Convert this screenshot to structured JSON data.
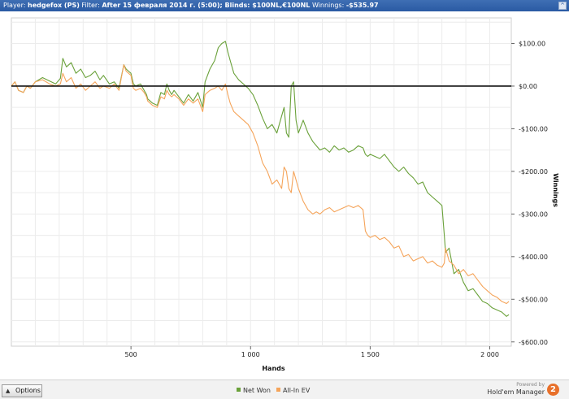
{
  "titlebar": {
    "player_label": "Player:",
    "player_value": "hedgefox (PS)",
    "filter_label": "Filter:",
    "filter_value": "After 15 февраля 2014 г. (5:00); Blinds: $100NL,€100NL",
    "winnings_label": "Winnings:",
    "winnings_value": "-$535.97",
    "collapse_icon": "chevron-up-icon",
    "collapse_glyph": "^"
  },
  "chart_data": {
    "type": "line",
    "xlabel": "Hands",
    "ylabel": "Winnings",
    "xlim": [
      0,
      2090
    ],
    "ylim": [
      -610,
      160
    ],
    "x_ticks": [
      500,
      1000,
      1500,
      2000
    ],
    "x_tick_labels": [
      "500",
      "1 000",
      "1 500",
      "2 000"
    ],
    "y_ticks": [
      100,
      0,
      -100,
      -200,
      -300,
      -400,
      -500,
      -600
    ],
    "y_tick_labels": [
      "$100.00",
      "$0.00",
      "-$100.00",
      "-$200.00",
      "-$300.00",
      "-$400.00",
      "-$500.00",
      "-$600.00"
    ],
    "grid": true,
    "zero_line": true,
    "legend_position": "bottom",
    "series": [
      {
        "name": "Net Won",
        "color": "#6aa13a",
        "x": [
          0,
          15,
          30,
          50,
          65,
          80,
          100,
          130,
          160,
          185,
          205,
          215,
          230,
          250,
          270,
          290,
          310,
          330,
          350,
          370,
          385,
          410,
          430,
          450,
          470,
          480,
          500,
          510,
          520,
          540,
          555,
          565,
          570,
          590,
          610,
          625,
          640,
          650,
          660,
          670,
          680,
          700,
          720,
          740,
          760,
          780,
          800,
          810,
          830,
          850,
          865,
          880,
          895,
          905,
          915,
          930,
          950,
          970,
          990,
          1010,
          1030,
          1050,
          1070,
          1090,
          1110,
          1130,
          1140,
          1150,
          1160,
          1170,
          1180,
          1190,
          1200,
          1220,
          1240,
          1260,
          1275,
          1290,
          1310,
          1330,
          1350,
          1370,
          1390,
          1410,
          1430,
          1450,
          1470,
          1480,
          1490,
          1500,
          1520,
          1540,
          1560,
          1580,
          1600,
          1620,
          1640,
          1660,
          1680,
          1700,
          1720,
          1740,
          1760,
          1780,
          1800,
          1810,
          1815,
          1830,
          1850,
          1870,
          1890,
          1910,
          1930,
          1950,
          1970,
          1990,
          2010,
          2030,
          2050,
          2070,
          2080
        ],
        "y": [
          0,
          10,
          -10,
          -15,
          0,
          -5,
          10,
          20,
          12,
          5,
          18,
          65,
          45,
          55,
          30,
          40,
          20,
          25,
          35,
          15,
          25,
          5,
          10,
          -5,
          50,
          40,
          30,
          5,
          0,
          5,
          -10,
          -20,
          -30,
          -40,
          -45,
          -15,
          -20,
          5,
          -10,
          -20,
          -10,
          -25,
          -40,
          -20,
          -35,
          -15,
          -50,
          10,
          40,
          60,
          90,
          100,
          105,
          80,
          60,
          30,
          15,
          5,
          -5,
          -20,
          -45,
          -75,
          -100,
          -90,
          -110,
          -70,
          -50,
          -110,
          -120,
          0,
          10,
          -80,
          -110,
          -80,
          -110,
          -130,
          -140,
          -150,
          -145,
          -155,
          -140,
          -150,
          -145,
          -155,
          -150,
          -140,
          -145,
          -160,
          -165,
          -160,
          -165,
          -170,
          -160,
          -175,
          -190,
          -200,
          -190,
          -205,
          -215,
          -230,
          -225,
          -250,
          -260,
          -270,
          -280,
          -350,
          -390,
          -380,
          -440,
          -430,
          -460,
          -480,
          -475,
          -490,
          -505,
          -510,
          -520,
          -525,
          -530,
          -540,
          -536
        ]
      },
      {
        "name": "All-In EV",
        "color": "#f5a45a",
        "x": [
          0,
          15,
          30,
          50,
          65,
          80,
          100,
          130,
          160,
          185,
          205,
          215,
          230,
          250,
          270,
          290,
          310,
          330,
          350,
          370,
          385,
          410,
          430,
          450,
          470,
          480,
          500,
          510,
          520,
          540,
          555,
          565,
          570,
          590,
          610,
          625,
          640,
          650,
          660,
          670,
          680,
          700,
          720,
          740,
          760,
          780,
          800,
          810,
          830,
          850,
          865,
          880,
          895,
          905,
          915,
          930,
          950,
          970,
          990,
          1010,
          1030,
          1050,
          1070,
          1090,
          1110,
          1130,
          1140,
          1150,
          1160,
          1170,
          1180,
          1190,
          1200,
          1220,
          1240,
          1260,
          1275,
          1290,
          1310,
          1330,
          1350,
          1370,
          1390,
          1410,
          1430,
          1450,
          1470,
          1480,
          1490,
          1500,
          1520,
          1540,
          1560,
          1580,
          1600,
          1620,
          1640,
          1660,
          1680,
          1700,
          1720,
          1740,
          1760,
          1780,
          1800,
          1810,
          1815,
          1830,
          1850,
          1870,
          1890,
          1910,
          1930,
          1950,
          1970,
          1990,
          2010,
          2030,
          2050,
          2070,
          2080
        ],
        "y": [
          0,
          10,
          -10,
          -15,
          0,
          -5,
          10,
          15,
          5,
          0,
          5,
          30,
          10,
          20,
          -5,
          5,
          -10,
          0,
          10,
          -5,
          0,
          -5,
          5,
          -10,
          50,
          35,
          25,
          -5,
          -10,
          -5,
          -15,
          -25,
          -35,
          -45,
          -50,
          -25,
          -30,
          -10,
          -20,
          -25,
          -20,
          -30,
          -45,
          -30,
          -40,
          -30,
          -60,
          -20,
          -10,
          -5,
          0,
          -10,
          5,
          -20,
          -40,
          -60,
          -70,
          -80,
          -90,
          -110,
          -140,
          -180,
          -200,
          -230,
          -220,
          -240,
          -190,
          -200,
          -240,
          -250,
          -200,
          -220,
          -240,
          -270,
          -290,
          -300,
          -295,
          -300,
          -290,
          -285,
          -295,
          -290,
          -285,
          -280,
          -285,
          -280,
          -290,
          -340,
          -350,
          -355,
          -350,
          -360,
          -355,
          -365,
          -380,
          -375,
          -400,
          -395,
          -410,
          -405,
          -400,
          -415,
          -410,
          -420,
          -425,
          -415,
          -380,
          -410,
          -420,
          -440,
          -430,
          -445,
          -440,
          -455,
          -470,
          -480,
          -490,
          -495,
          -505,
          -510,
          -505
        ]
      }
    ]
  },
  "footer": {
    "options_label": "Options",
    "options_icon": "triangle-up-icon",
    "options_glyph": "▲",
    "powered_text": "Powered by",
    "brand_text": "Hold'em Manager",
    "brand_badge": "2"
  }
}
